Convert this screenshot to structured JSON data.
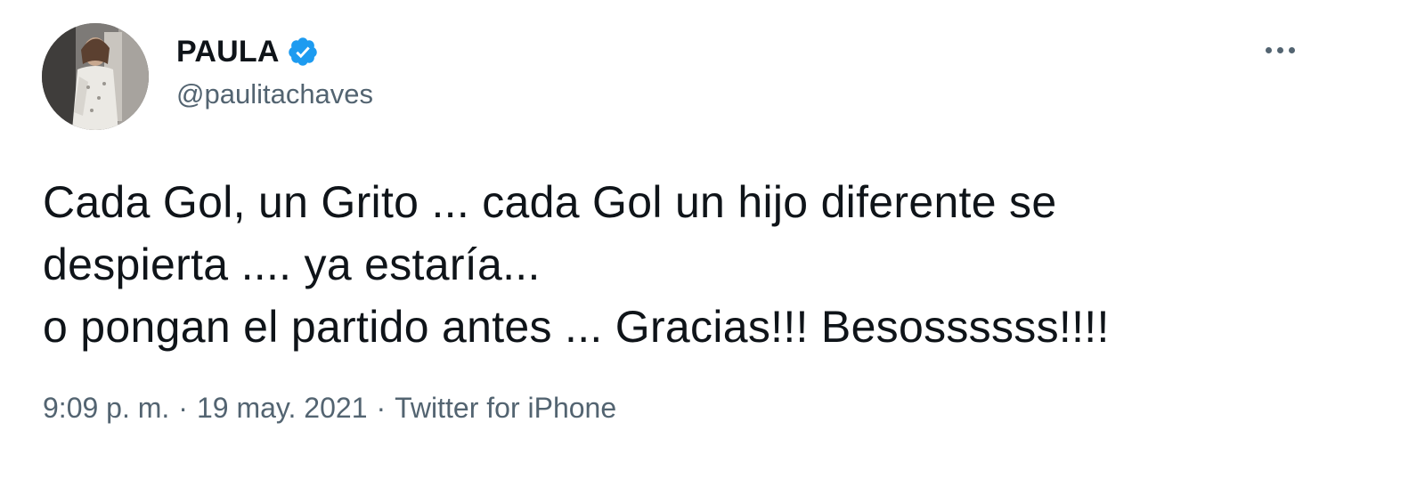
{
  "user": {
    "display_name": "PAULA",
    "handle": "@paulitachaves",
    "verified": true,
    "verified_icon": "verified-badge-icon",
    "avatar_icon": "avatar"
  },
  "menu": {
    "icon": "more-horizontal-icon"
  },
  "tweet": {
    "lines": [
      "Cada Gol, un Grito ... cada Gol un hijo diferente se",
      "despierta .... ya estaría...",
      "o pongan el partido antes ... Gracias!!! Besossssss!!!!"
    ]
  },
  "meta": {
    "time": "9:09 p. m.",
    "separator": "·",
    "date": "19 may. 2021",
    "source": "Twitter for iPhone"
  },
  "colors": {
    "text_primary": "#0f1419",
    "text_secondary": "#536471",
    "verified_blue": "#1d9bf0",
    "background": "#ffffff"
  }
}
